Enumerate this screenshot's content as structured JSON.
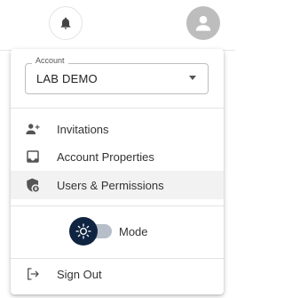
{
  "header": {
    "notifications_icon": "bell-icon",
    "account_icon": "account-circle-icon"
  },
  "menu": {
    "account": {
      "label": "Account",
      "value": "LAB DEMO"
    },
    "items": [
      {
        "label": "Invitations",
        "icon": "person-add-icon"
      },
      {
        "label": "Account Properties",
        "icon": "inbox-icon"
      },
      {
        "label": "Users & Permissions",
        "icon": "shield-lock-icon",
        "selected": true
      }
    ],
    "mode": {
      "label": "Mode",
      "icon": "sun-icon",
      "dark": false
    },
    "sign_out": {
      "label": "Sign Out",
      "icon": "logout-icon"
    }
  },
  "colors": {
    "knob": "#0f2440",
    "track": "#b7bec9",
    "selected_bg": "#f2f2f2",
    "avatar_bg": "#bdbdbd"
  }
}
